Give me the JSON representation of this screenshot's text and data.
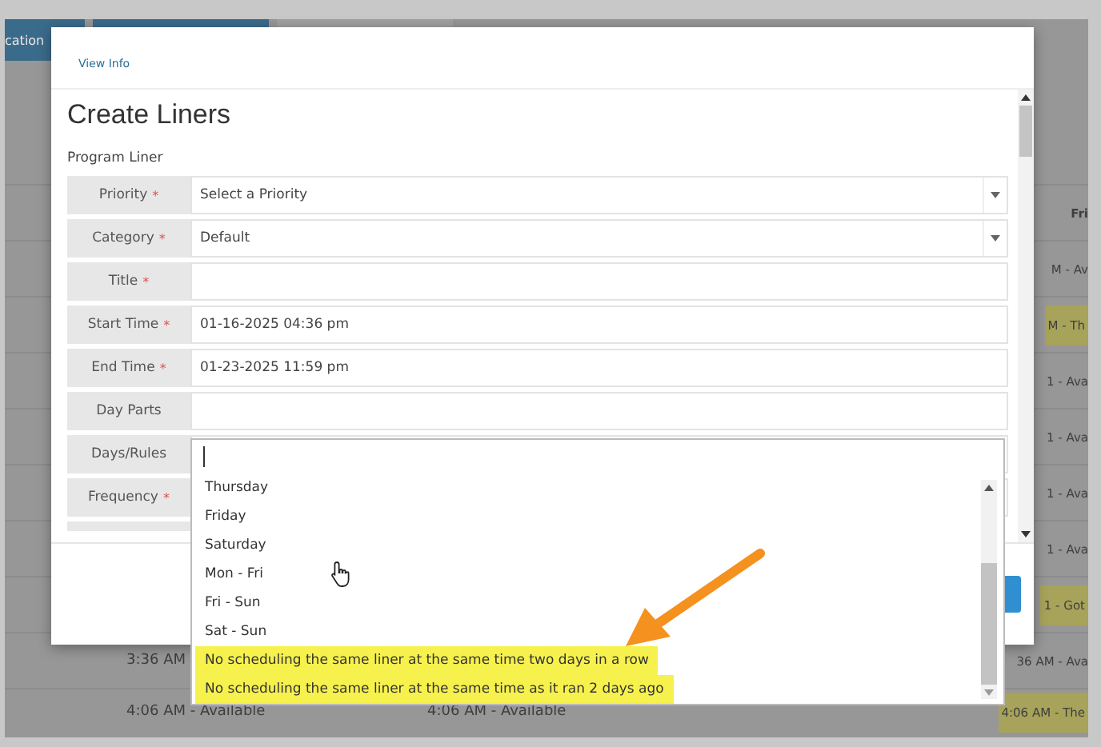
{
  "backdrop": {
    "tabs": [
      {
        "label": "cation",
        "selected": true
      },
      {
        "selected": true
      },
      {
        "selected": false
      }
    ],
    "table": {
      "rows": [
        {
          "cells": [
            null,
            null,
            null,
            {
              "text": "Fri",
              "highlighted": false
            }
          ],
          "kind": "header"
        },
        {
          "cells": [
            null,
            null,
            null,
            {
              "text": "M - Av",
              "highlighted": false
            }
          ],
          "kind": "row"
        },
        {
          "cells": [
            null,
            null,
            null,
            {
              "text": "M - Th",
              "highlighted": true
            }
          ],
          "kind": "row"
        },
        {
          "cells": [
            null,
            null,
            null,
            {
              "text": "1 - Ava",
              "highlighted": false
            }
          ],
          "kind": "row"
        },
        {
          "cells": [
            null,
            null,
            null,
            {
              "text": "1 - Ava",
              "highlighted": false
            }
          ],
          "kind": "row"
        },
        {
          "cells": [
            null,
            null,
            null,
            {
              "text": "1 - Ava",
              "highlighted": false
            }
          ],
          "kind": "row"
        },
        {
          "cells": [
            null,
            null,
            null,
            {
              "text": "1 - Ava",
              "highlighted": false
            }
          ],
          "kind": "row"
        },
        {
          "cells": [
            null,
            null,
            null,
            {
              "text": "1 - Got",
              "highlighted": true
            }
          ],
          "kind": "row"
        },
        {
          "cells": [
            null,
            {
              "text": "3:36 AM",
              "highlighted": false
            },
            null,
            {
              "text": "36 AM - Ava",
              "highlighted": false
            }
          ],
          "kind": "row"
        },
        {
          "cells": [
            null,
            {
              "text": "4:06 AM - Available",
              "highlighted": false
            },
            {
              "text": "4:06 AM - Available",
              "highlighted": false
            },
            {
              "text": "4:06 AM - The",
              "highlighted": true
            }
          ],
          "kind": "row"
        }
      ]
    }
  },
  "dialog": {
    "header_link": "View Info",
    "title": "Create Liners",
    "section": "Program Liner",
    "fields": [
      {
        "kind": "select",
        "label": "Priority",
        "mark": "*",
        "value": "Select a Priority"
      },
      {
        "kind": "select",
        "label": "Category",
        "mark": "*",
        "value": "Default"
      },
      {
        "kind": "text",
        "label": "Title",
        "mark": "*"
      },
      {
        "kind": "text",
        "label": "Start Time",
        "mark": "*",
        "value": "01-16-2025 04:36 pm"
      },
      {
        "kind": "text",
        "label": "End Time",
        "mark": "*",
        "value": "01-23-2025 11:59 pm"
      },
      {
        "kind": "text",
        "label": "Day Parts"
      },
      {
        "kind": "text",
        "label": "Days/Rules"
      },
      {
        "kind": "text",
        "label": "Frequency",
        "mark": "*"
      },
      {
        "kind": "partial"
      }
    ],
    "dropdown": {
      "focused": true,
      "items": [
        {
          "label": "Thursday",
          "highlighted": false
        },
        {
          "label": "Friday",
          "highlighted": false
        },
        {
          "label": "Saturday",
          "highlighted": false
        },
        {
          "label": "Mon - Fri",
          "highlighted": false
        },
        {
          "label": "Fri - Sun",
          "highlighted": false
        },
        {
          "label": "Sat - Sun",
          "highlighted": false
        },
        {
          "label": "No scheduling the same liner at the same time two days in a row",
          "highlighted": true
        },
        {
          "label": "No scheduling the same liner at the same time as it ran 2 days ago",
          "highlighted": true
        }
      ]
    }
  }
}
